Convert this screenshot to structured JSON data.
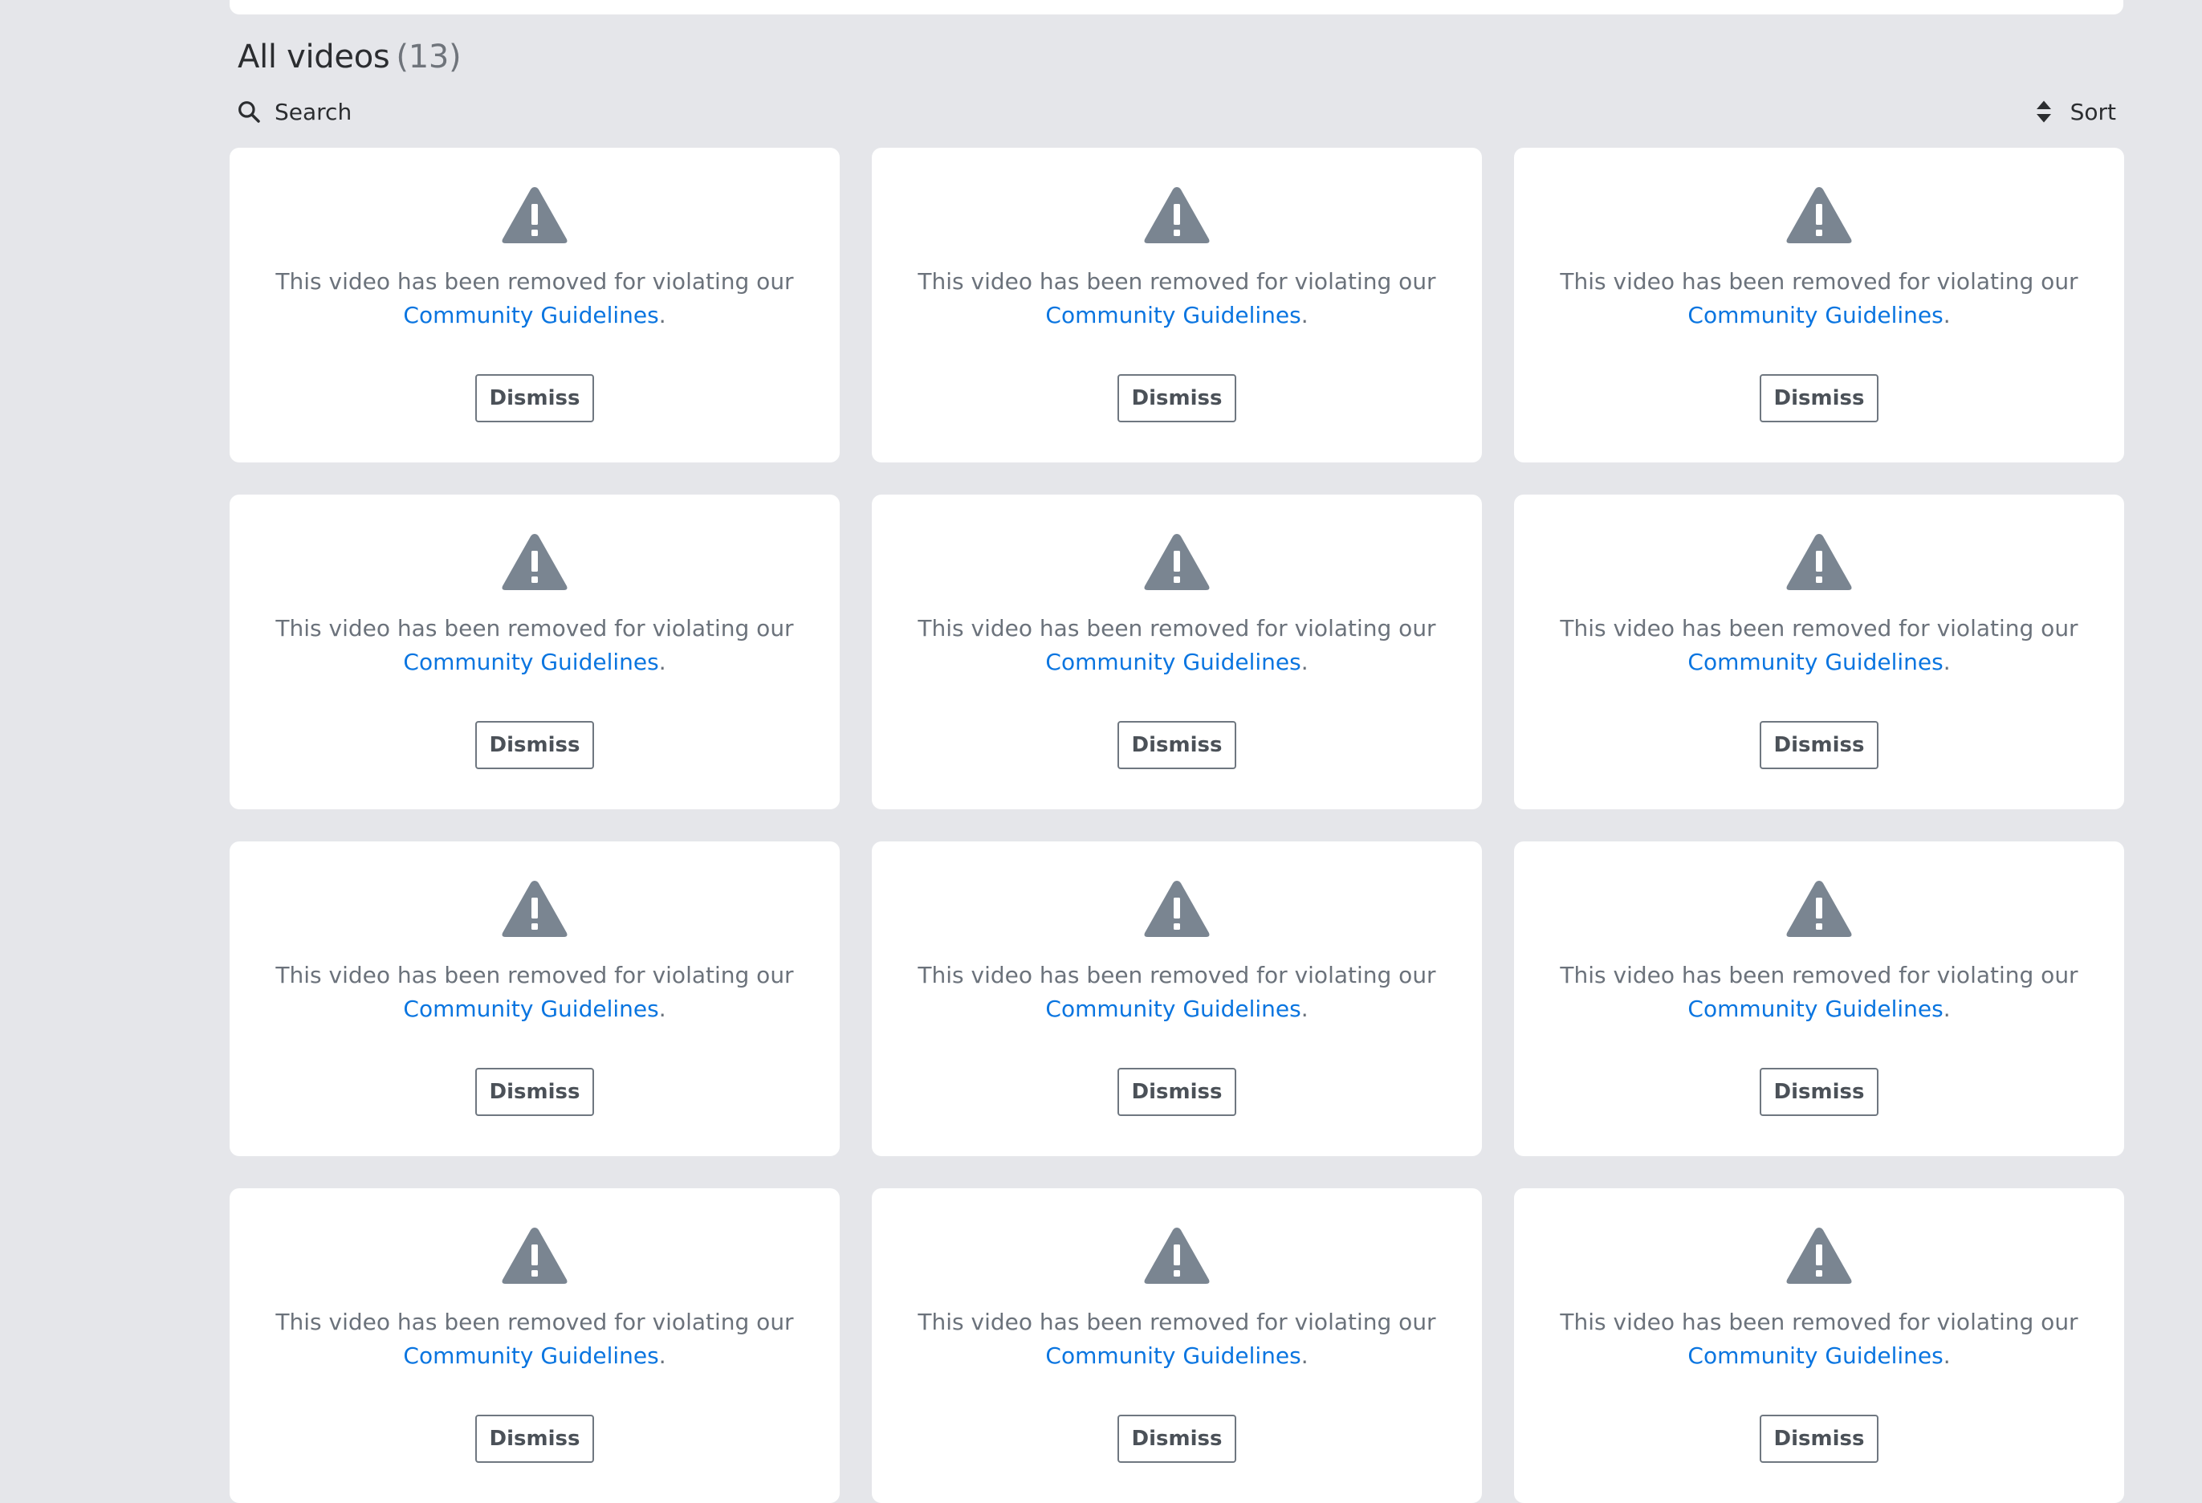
{
  "header": {
    "title": "All videos",
    "count": "(13)"
  },
  "toolbar": {
    "search_label": "Search",
    "search_icon": "search-icon",
    "sort_label": "Sort",
    "sort_icon": "sort-icon"
  },
  "colors": {
    "background": "#e5e6ea",
    "card": "#ffffff",
    "warning_icon": "#7a8591",
    "link": "#0a75e0",
    "message_text": "#6b727b"
  },
  "cards": [
    {
      "message": "This video has been removed for violating our",
      "link_text": "Community Guidelines",
      "suffix": ".",
      "button_label": "Dismiss",
      "icon": "warning-icon"
    },
    {
      "message": "This video has been removed for violating our",
      "link_text": "Community Guidelines",
      "suffix": ".",
      "button_label": "Dismiss",
      "icon": "warning-icon"
    },
    {
      "message": "This video has been removed for violating our",
      "link_text": "Community Guidelines",
      "suffix": ".",
      "button_label": "Dismiss",
      "icon": "warning-icon"
    },
    {
      "message": "This video has been removed for violating our",
      "link_text": "Community Guidelines",
      "suffix": ".",
      "button_label": "Dismiss",
      "icon": "warning-icon"
    },
    {
      "message": "This video has been removed for violating our",
      "link_text": "Community Guidelines",
      "suffix": ".",
      "button_label": "Dismiss",
      "icon": "warning-icon"
    },
    {
      "message": "This video has been removed for violating our",
      "link_text": "Community Guidelines",
      "suffix": ".",
      "button_label": "Dismiss",
      "icon": "warning-icon"
    },
    {
      "message": "This video has been removed for violating our",
      "link_text": "Community Guidelines",
      "suffix": ".",
      "button_label": "Dismiss",
      "icon": "warning-icon"
    },
    {
      "message": "This video has been removed for violating our",
      "link_text": "Community Guidelines",
      "suffix": ".",
      "button_label": "Dismiss",
      "icon": "warning-icon"
    },
    {
      "message": "This video has been removed for violating our",
      "link_text": "Community Guidelines",
      "suffix": ".",
      "button_label": "Dismiss",
      "icon": "warning-icon"
    },
    {
      "message": "This video has been removed for violating our",
      "link_text": "Community Guidelines",
      "suffix": ".",
      "button_label": "Dismiss",
      "icon": "warning-icon"
    },
    {
      "message": "This video has been removed for violating our",
      "link_text": "Community Guidelines",
      "suffix": ".",
      "button_label": "Dismiss",
      "icon": "warning-icon"
    },
    {
      "message": "This video has been removed for violating our",
      "link_text": "Community Guidelines",
      "suffix": ".",
      "button_label": "Dismiss",
      "icon": "warning-icon"
    }
  ]
}
